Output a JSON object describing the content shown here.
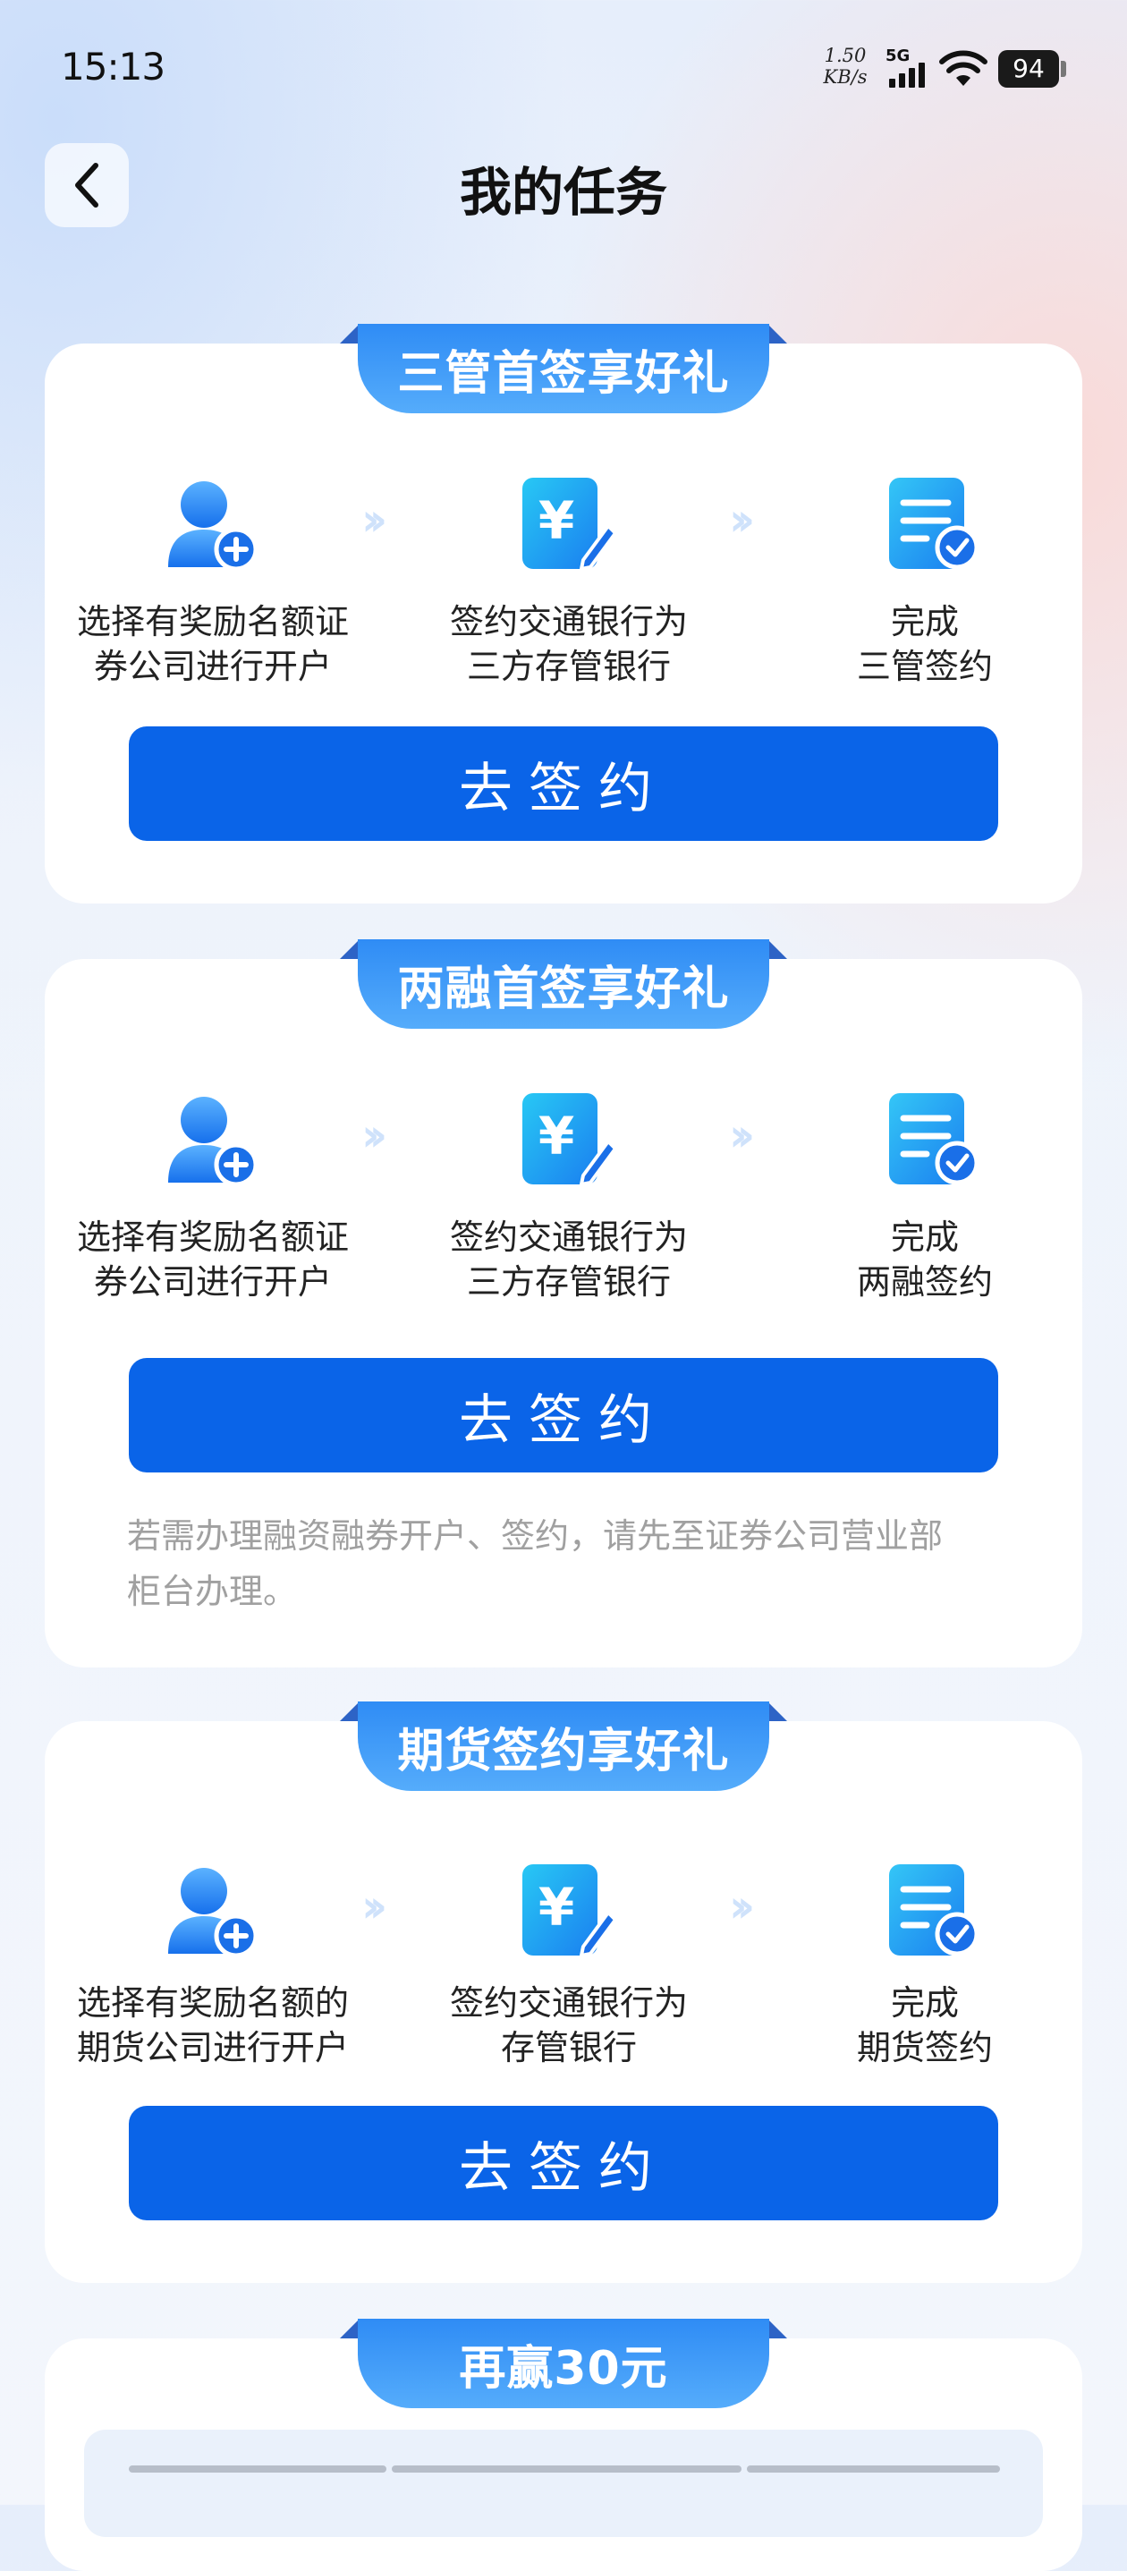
{
  "status_bar": {
    "time": "15:13",
    "net_speed_value": "1.50",
    "net_speed_unit": "KB/s",
    "network_type": "5G",
    "battery": "94"
  },
  "header": {
    "title": "我的任务"
  },
  "cards": [
    {
      "ribbon": "三管首签享好礼",
      "steps": [
        {
          "line1": "选择有奖励名额证",
          "line2": "券公司进行开户",
          "icon": "user-add-icon"
        },
        {
          "line1": "签约交通银行为",
          "line2": "三方存管银行",
          "icon": "yuan-sign-icon"
        },
        {
          "line1": "完成",
          "line2": "三管签约",
          "icon": "document-check-icon"
        }
      ],
      "button": "去签约"
    },
    {
      "ribbon": "两融首签享好礼",
      "steps": [
        {
          "line1": "选择有奖励名额证",
          "line2": "券公司进行开户",
          "icon": "user-add-icon"
        },
        {
          "line1": "签约交通银行为",
          "line2": "三方存管银行",
          "icon": "yuan-sign-icon"
        },
        {
          "line1": "完成",
          "line2": "两融签约",
          "icon": "document-check-icon"
        }
      ],
      "button": "去签约",
      "note_line1": "若需办理融资融券开户、签约，请先至证券公司营业部",
      "note_line2": "柜台办理。"
    },
    {
      "ribbon": "期货签约享好礼",
      "steps": [
        {
          "line1": "选择有奖励名额的",
          "line2": "期货公司进行开户",
          "icon": "user-add-icon"
        },
        {
          "line1": "签约交通银行为",
          "line2": "存管银行",
          "icon": "yuan-sign-icon"
        },
        {
          "line1": "完成",
          "line2": "期货签约",
          "icon": "document-check-icon"
        }
      ],
      "button": "去签约"
    },
    {
      "ribbon": "再赢30元"
    }
  ],
  "colors": {
    "primary_button": "#0a64e8",
    "ribbon": "#3a95f7",
    "icon_blue": "#1a7ff0",
    "note_text": "#a0a0a0"
  }
}
